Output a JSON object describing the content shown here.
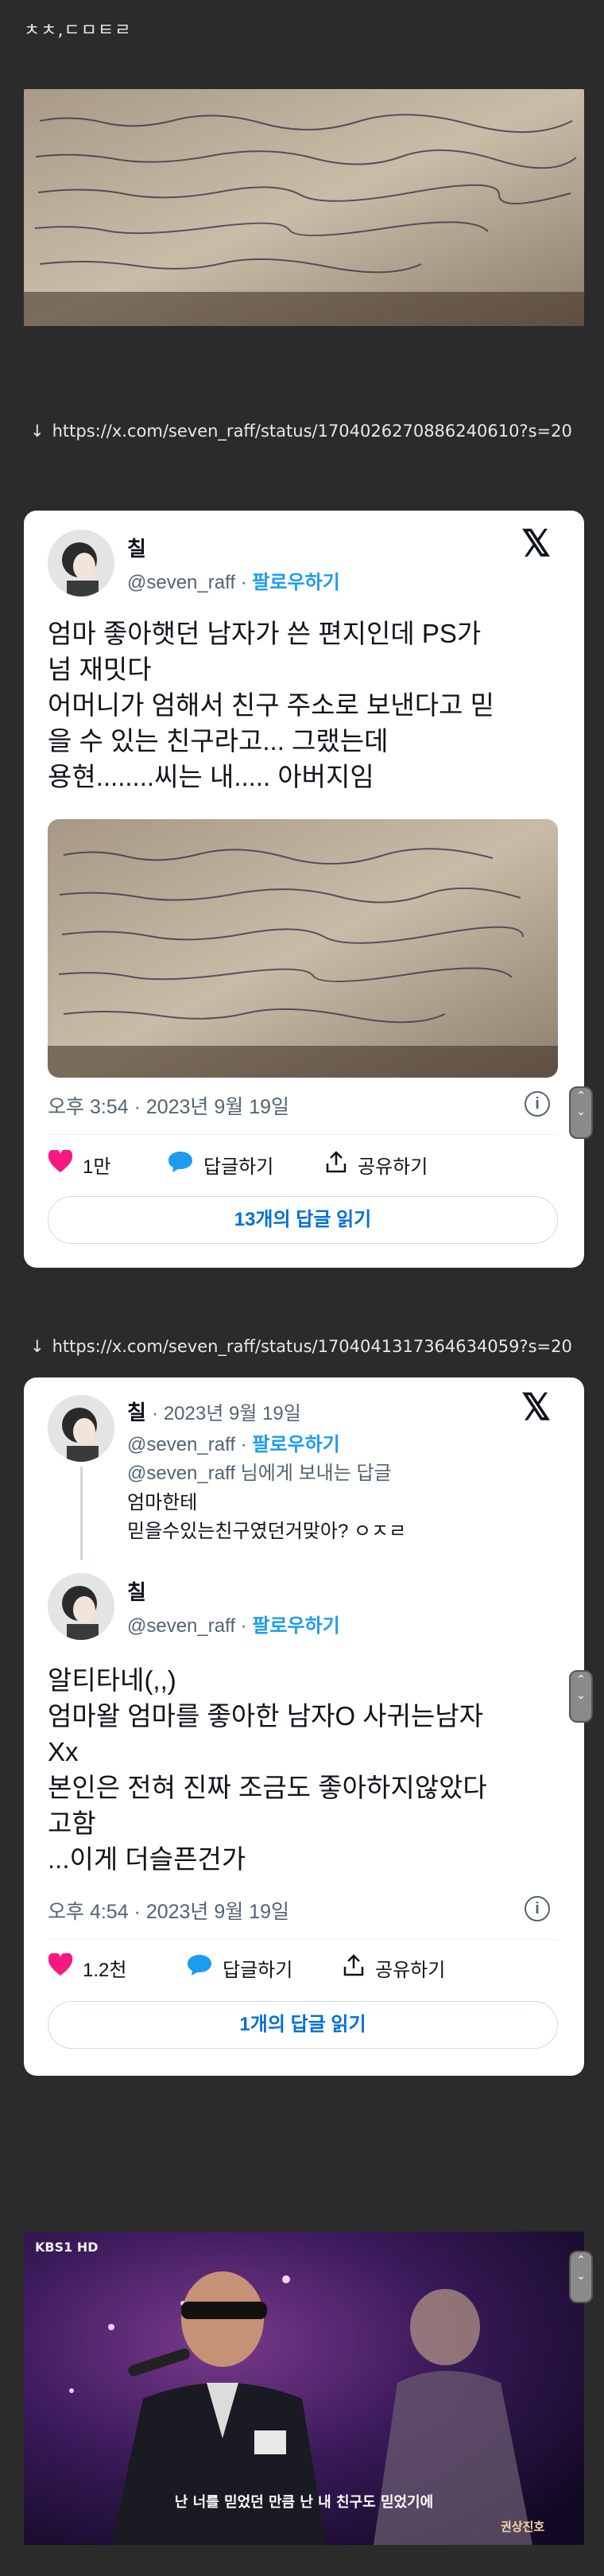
{
  "site_tag": "ㅊㅊ,ㄷㅁㅌㄹ",
  "links": [
    {
      "arrow": "↓",
      "url": "https://x.com/seven_raff/status/1704026270886240610?s=20"
    },
    {
      "arrow": "↓",
      "url": "https://x.com/seven_raff/status/1704041317364634059?s=20"
    }
  ],
  "tweet1": {
    "name": "칠",
    "handle": "@seven_raff",
    "dot": "·",
    "follow": "팔로우하기",
    "text_lines": [
      "엄마 좋아햇던 남자가 쓴 편지인데 PS가",
      "넘 재밋다",
      "어머니가 엄해서 친구 주소로 보낸다고 믿",
      "을 수 있는 친구라고... 그랬는데",
      "용현........씨는 내..... 아버지임"
    ],
    "timestamp": "오후 3:54 · 2023년 9월 19일",
    "likes": "1만",
    "reply_label": "답글하기",
    "share_label": "공유하기",
    "read_replies": "13개의 답글 읽기"
  },
  "tweet2": {
    "parent_name": "칠",
    "parent_date": "· 2023년 9월 19일",
    "handle": "@seven_raff",
    "dot": "·",
    "follow": "팔로우하기",
    "reply_to": "@seven_raff 님에게 보내는 답글",
    "parent_lines": [
      "엄마한테",
      "믿을수있는친구였던거맞아? ㅇㅈㄹ"
    ],
    "name": "칠",
    "text_lines": [
      "알티타네(,,)",
      "엄마왈 엄마를 좋아한 남자O 사귀는남자",
      "Xx",
      "본인은 전혀 진짜 조금도 좋아하지않았다",
      "고함",
      "...이게 더슬픈건가"
    ],
    "timestamp": "오후 4:54 · 2023년 9월 19일",
    "likes": "1.2천",
    "reply_label": "답글하기",
    "share_label": "공유하기",
    "read_replies": "1개의 답글 읽기"
  },
  "tv_still": {
    "channel": "KBS1 HD",
    "subtitle": "난 너를 믿었던 만큼 난 내 친구도 믿었기에",
    "corner_logo": "권상진호"
  },
  "icons": {
    "x_logo": "𝕏",
    "heart": "heart-icon",
    "reply": "speech-bubble-icon",
    "share": "share-icon",
    "info": "info-icon"
  }
}
